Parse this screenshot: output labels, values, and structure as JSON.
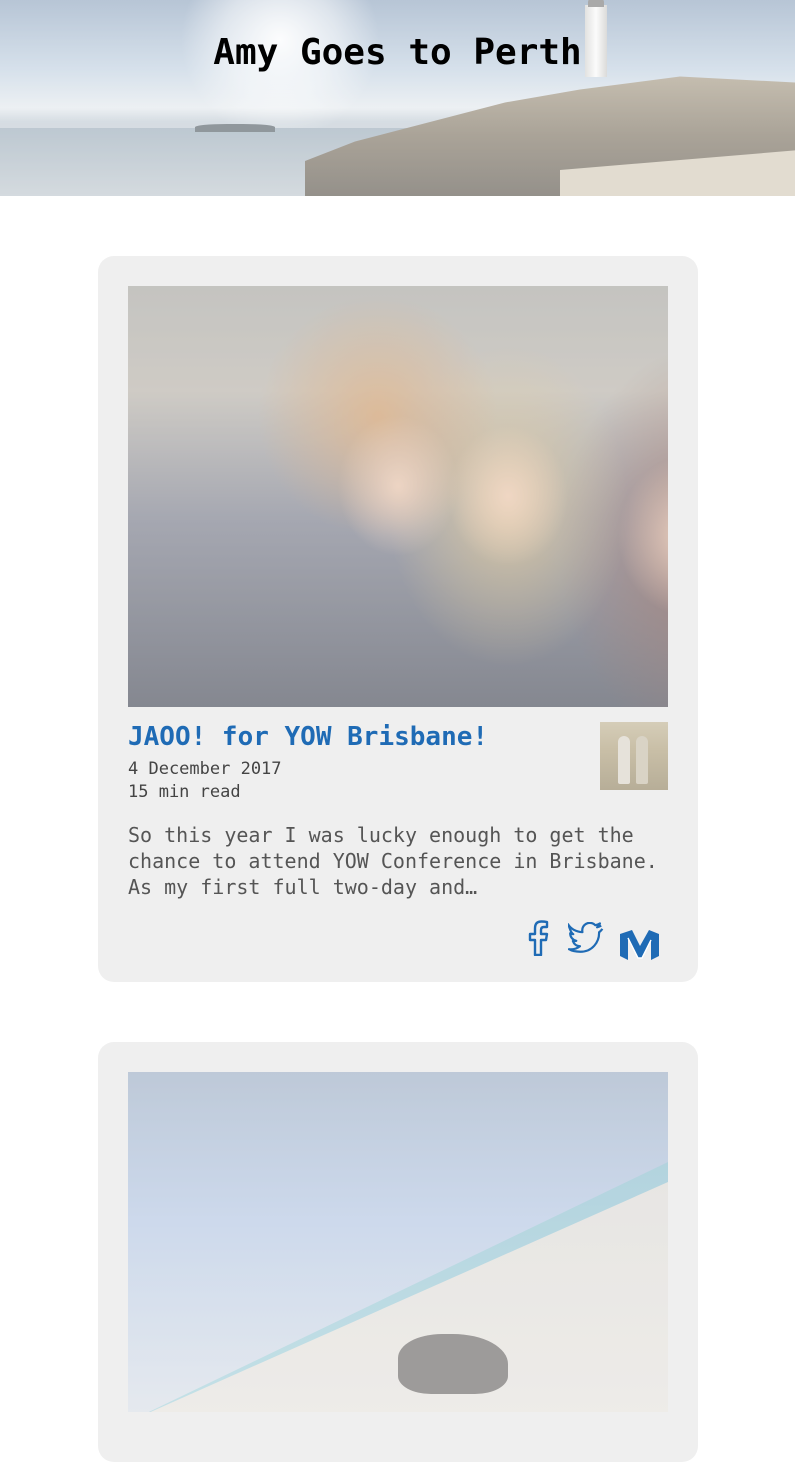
{
  "site": {
    "title": "Amy Goes to Perth"
  },
  "posts": [
    {
      "title": "JAOO! for YOW Brisbane!",
      "date": "4 December 2017",
      "read_time": "15 min read",
      "excerpt": "So this year I was lucky enough to get the chance to attend YOW Conference in Brisbane. As my first full two-day and…",
      "image": "selfie-photo",
      "author_avatar": "author-avatar",
      "share": [
        "facebook-icon",
        "twitter-icon",
        "medium-icon"
      ]
    },
    {
      "image": "beach-dog-photo"
    }
  ],
  "colors": {
    "accent": "#1f6bb5",
    "card_bg": "#efefef",
    "text_muted": "#555555"
  }
}
